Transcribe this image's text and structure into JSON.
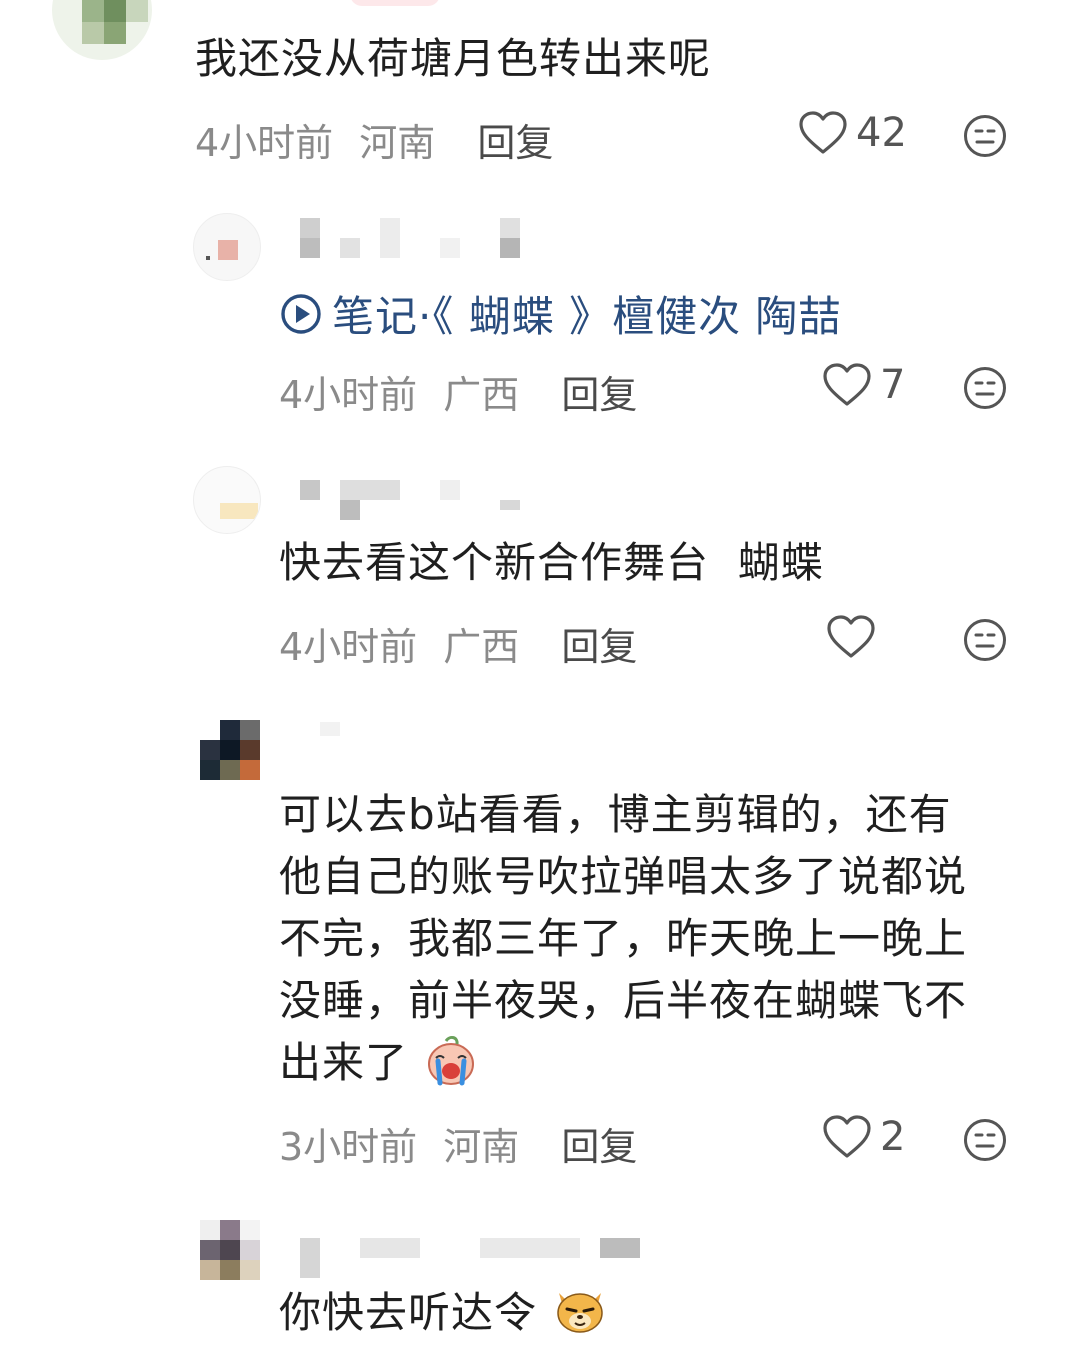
{
  "comments": [
    {
      "text": "我还没从荷塘月色转出来呢",
      "time": "4小时前",
      "location": "河南",
      "reply_label": "回复",
      "likes": "42"
    },
    {
      "note_prefix": "笔记",
      "note_title": "·《 蝴蝶 》檀健次 陶喆",
      "time": "4小时前",
      "location": "广西",
      "reply_label": "回复",
      "likes": "7"
    },
    {
      "text": "快去看这个新合作舞台  蝴蝶",
      "time": "4小时前",
      "location": "广西",
      "reply_label": "回复",
      "likes": ""
    },
    {
      "text_lines": [
        "可以去b站看看，博主剪辑的，还有",
        "他自己的账号吹拉弹唱太多了说都说",
        "不完，我都三年了，昨天晚上一晚上",
        "没睡，前半夜哭，后半夜在蝴蝶飞不",
        "出来了"
      ],
      "emoji": "crying-face-emoji",
      "time": "3小时前",
      "location": "河南",
      "reply_label": "回复",
      "likes": "2"
    },
    {
      "text": "你快去听达令",
      "emoji": "dog-face-emoji"
    }
  ],
  "colors": {
    "link_blue": "#2a4d7e",
    "meta_gray": "#8a8a8a",
    "text": "#1f1f1f"
  }
}
